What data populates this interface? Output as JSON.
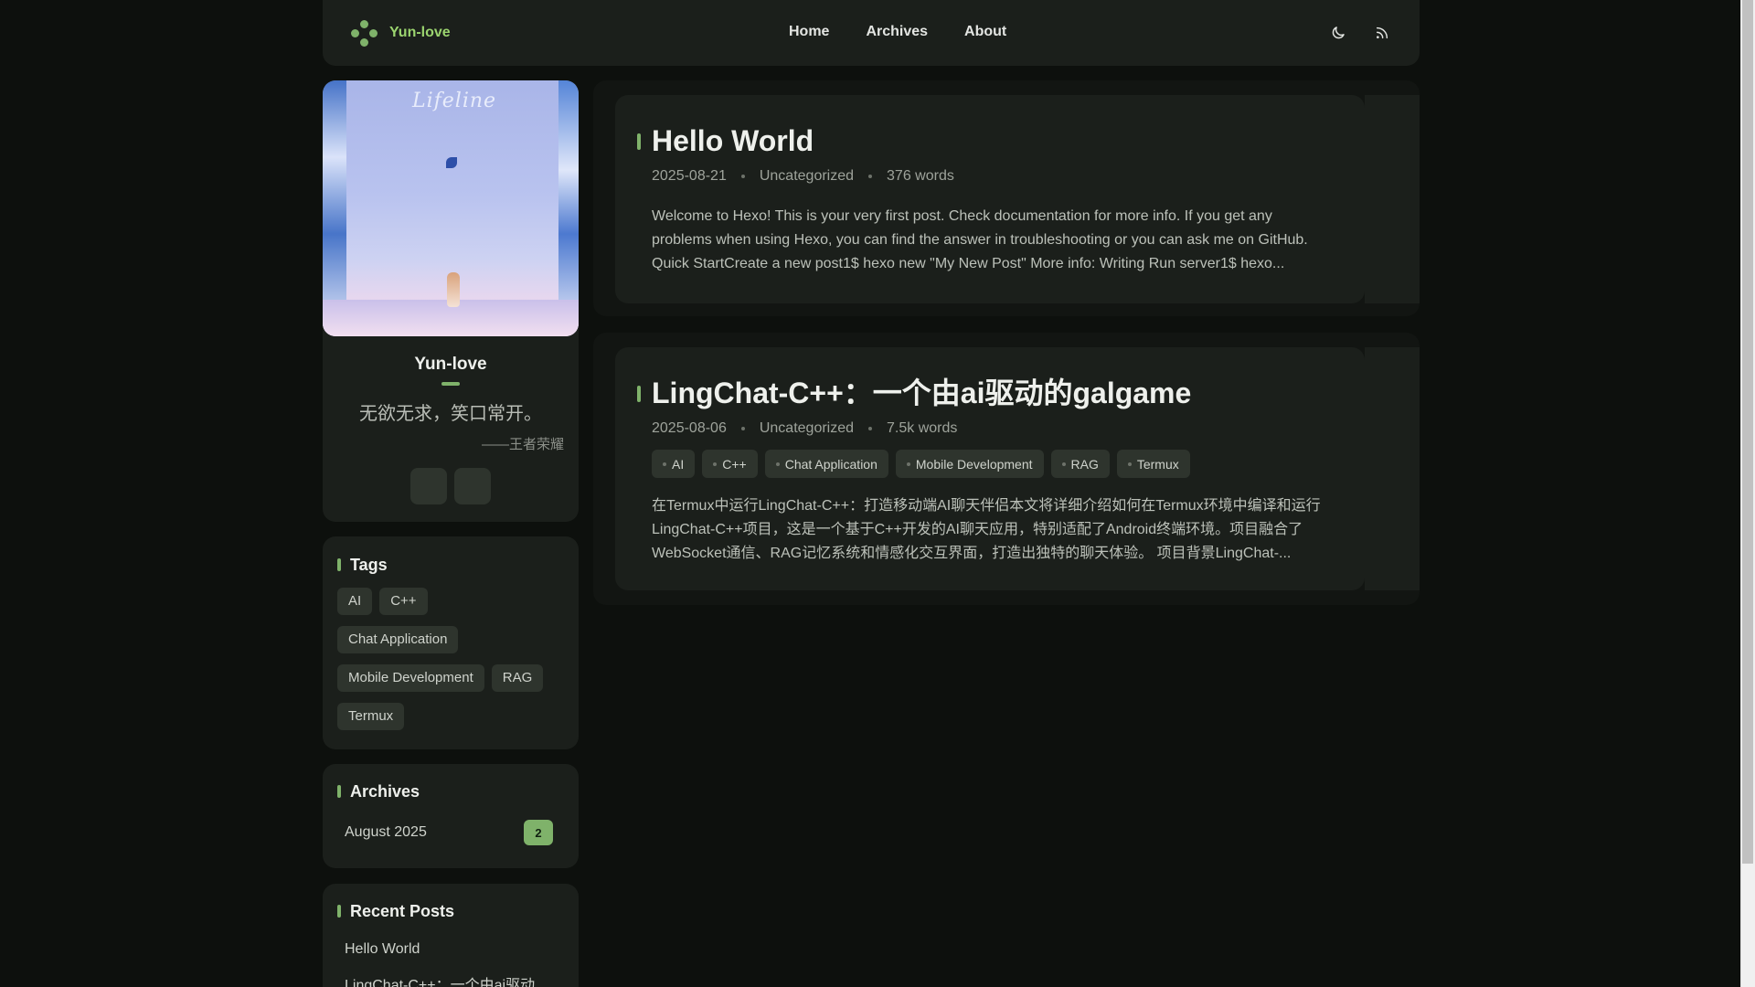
{
  "site": {
    "brand": "Yun-love"
  },
  "nav": {
    "items": [
      "Home",
      "Archives",
      "About"
    ]
  },
  "profile": {
    "name": "Yun-love",
    "motto": "无欲无求，笑口常开。",
    "motto_source": "——王者荣耀",
    "image_caption": "Lifeline"
  },
  "tags": {
    "title": "Tags",
    "items": [
      "AI",
      "C++",
      "Chat Application",
      "Mobile Development",
      "RAG",
      "Termux"
    ]
  },
  "archives": {
    "title": "Archives",
    "items": [
      {
        "label": "August 2025",
        "count": "2"
      }
    ]
  },
  "recent": {
    "title": "Recent Posts",
    "items": [
      "Hello World",
      "LingChat-C++：一个由ai驱动"
    ]
  },
  "posts": [
    {
      "title": "Hello World",
      "date": "2025-08-21",
      "category": "Uncategorized",
      "words": "376 words",
      "tags": [],
      "excerpt": "Welcome to Hexo! This is your very first post. Check documentation for more info. If you get any problems when using Hexo, you can find the answer in troubleshooting or you can ask me on GitHub. Quick StartCreate a new post1$ hexo new \"My New Post\" More info: Writing Run server1$ hexo..."
    },
    {
      "title": "LingChat-C++：一个由ai驱动的galgame",
      "date": "2025-08-06",
      "category": "Uncategorized",
      "words": "7.5k words",
      "tags": [
        "AI",
        "C++",
        "Chat Application",
        "Mobile Development",
        "RAG",
        "Termux"
      ],
      "excerpt": "在Termux中运行LingChat-C++：打造移动端AI聊天伴侣本文将详细介绍如何在Termux环境中编译和运行LingChat-C++项目，这是一个基于C++开发的AI聊天应用，特别适配了Android终端环境。项目融合了WebSocket通信、RAG记忆系统和情感化交互界面，打造出独特的聊天体验。 项目背景LingChat-..."
    }
  ],
  "colors": {
    "accent": "#7fb26a",
    "card": "#1b1f1b",
    "background": "#0d100d"
  },
  "icons": {
    "logo": "flower-logo-icon",
    "theme": "moon-icon",
    "rss": "rss-icon"
  }
}
